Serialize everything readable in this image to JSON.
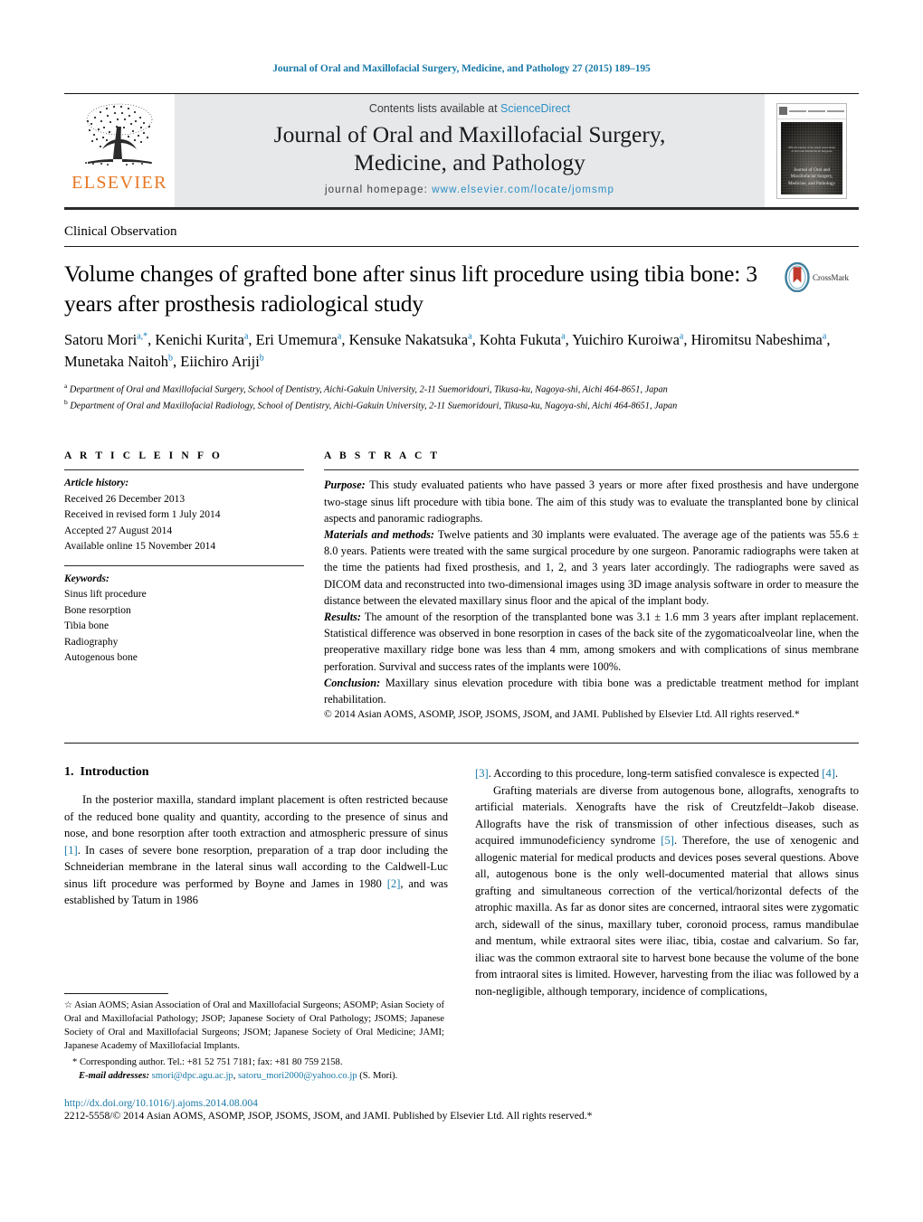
{
  "running_head": "Journal of Oral and Maxillofacial Surgery, Medicine, and Pathology 27 (2015) 189–195",
  "masthead": {
    "publisher_word": "ELSEVIER",
    "contents_prefix": "Contents lists available at ",
    "contents_link": "ScienceDirect",
    "journal_title_line1": "Journal of Oral and Maxillofacial Surgery,",
    "journal_title_line2": "Medicine, and Pathology",
    "homepage_prefix": "journal homepage: ",
    "homepage_url": "www.elsevier.com/locate/jomsmp",
    "cover_title": "Journal of Oral and Maxillofacial Surgery, Medicine, and Pathology",
    "cover_mini": "Official Journal of the Asian Association of Oral and Maxillofacial Surgeons"
  },
  "article": {
    "doctype": "Clinical Observation",
    "title": "Volume changes of grafted bone after sinus lift procedure using tibia bone: 3 years after prosthesis radiological study",
    "crossmark_label": "CrossMark",
    "authors": [
      {
        "name": "Satoru Mori",
        "sup": "a,*"
      },
      {
        "name": "Kenichi Kurita",
        "sup": "a"
      },
      {
        "name": "Eri Umemura",
        "sup": "a"
      },
      {
        "name": "Kensuke Nakatsuka",
        "sup": "a"
      },
      {
        "name": "Kohta Fukuta",
        "sup": "a"
      },
      {
        "name": "Yuichiro Kuroiwa",
        "sup": "a"
      },
      {
        "name": "Hiromitsu Nabeshima",
        "sup": "a"
      },
      {
        "name": "Munetaka Naitoh",
        "sup": "b"
      },
      {
        "name": "Eiichiro Ariji",
        "sup": "b"
      }
    ],
    "affiliations": [
      {
        "mark": "a",
        "text": "Department of Oral and Maxillofacial Surgery, School of Dentistry, Aichi-Gakuin University, 2-11 Suemoridouri, Tikusa-ku, Nagoya-shi, Aichi 464-8651, Japan"
      },
      {
        "mark": "b",
        "text": "Department of Oral and Maxillofacial Radiology, School of Dentistry, Aichi-Gakuin University, 2-11 Suemoridouri, Tikusa-ku, Nagoya-shi, Aichi 464-8651, Japan"
      }
    ]
  },
  "article_info": {
    "heading": "A R T I C L E   I N F O",
    "history_label": "Article history:",
    "history": [
      "Received 26 December 2013",
      "Received in revised form 1 July 2014",
      "Accepted 27 August 2014",
      "Available online 15 November 2014"
    ],
    "keywords_label": "Keywords:",
    "keywords": [
      "Sinus lift procedure",
      "Bone resorption",
      "Tibia bone",
      "Radiography",
      "Autogenous bone"
    ]
  },
  "abstract": {
    "heading": "A B S T R A C T",
    "sections": [
      {
        "label": "Purpose:",
        "text": " This study evaluated patients who have passed 3 years or more after fixed prosthesis and have undergone two-stage sinus lift procedure with tibia bone. The aim of this study was to evaluate the transplanted bone by clinical aspects and panoramic radiographs."
      },
      {
        "label": "Materials and methods:",
        "text": " Twelve patients and 30 implants were evaluated. The average age of the patients was 55.6 ± 8.0 years. Patients were treated with the same surgical procedure by one surgeon. Panoramic radiographs were taken at the time the patients had fixed prosthesis, and 1, 2, and 3 years later accordingly. The radiographs were saved as DICOM data and reconstructed into two-dimensional images using 3D image analysis software in order to measure the distance between the elevated maxillary sinus floor and the apical of the implant body."
      },
      {
        "label": "Results:",
        "text": " The amount of the resorption of the transplanted bone was 3.1 ± 1.6 mm 3 years after implant replacement. Statistical difference was observed in bone resorption in cases of the back site of the zygomaticoalveolar line, when the preoperative maxillary ridge bone was less than 4 mm, among smokers and with complications of sinus membrane perforation. Survival and success rates of the implants were 100%."
      },
      {
        "label": "Conclusion:",
        "text": " Maxillary sinus elevation procedure with tibia bone was a predictable treatment method for implant rehabilitation."
      }
    ],
    "copyright": "© 2014 Asian AOMS, ASOMP, JSOP, JSOMS, JSOM, and JAMI. Published by Elsevier Ltd. All rights reserved.*"
  },
  "body": {
    "section_number": "1.",
    "section_title": "Introduction",
    "left_paragraph_1a": "In the posterior maxilla, standard implant placement is often restricted because of the reduced bone quality and quantity, according to the presence of sinus and nose, and bone resorption after tooth extraction and atmospheric pressure of sinus ",
    "left_ref_1": "[1]",
    "left_paragraph_1b": ". In cases of severe bone resorption, preparation of a trap door including the Schneiderian membrane in the lateral sinus wall according to the Caldwell-Luc sinus lift procedure was performed by Boyne and James in 1980 ",
    "left_ref_2": "[2]",
    "left_paragraph_1c": ", and was established by Tatum in 1986 ",
    "right_ref_3": "[3]",
    "right_paragraph_1a": ". According to this procedure, long-term satisfied convalesce is expected ",
    "right_ref_4": "[4]",
    "right_paragraph_1b": ".",
    "right_paragraph_2a": "Grafting materials are diverse from autogenous bone, allografts, xenografts to artificial materials. Xenografts have the risk of Creutzfeldt–Jakob disease. Allografts have the risk of transmission of other infectious diseases, such as acquired immunodeficiency syndrome ",
    "right_ref_5": "[5]",
    "right_paragraph_2b": ". Therefore, the use of xenogenic and allogenic material for medical products and devices poses several questions. Above all, autogenous bone is the only well-documented material that allows sinus grafting and simultaneous correction of the vertical/horizontal defects of the atrophic maxilla. As far as donor sites are concerned, intraoral sites were zygomatic arch, sidewall of the sinus, maxillary tuber, coronoid process, ramus mandibulae and mentum, while extraoral sites were iliac, tibia, costae and calvarium. So far, iliac was the common extraoral site to harvest bone because the volume of the bone from intraoral sites is limited. However, harvesting from the iliac was followed by a non-negligible, although temporary, incidence of complications,"
  },
  "footnotes": {
    "societies": "Asian AOMS; Asian Association of Oral and Maxillofacial Surgeons; ASOMP; Asian Society of Oral and Maxillofacial Pathology; JSOP; Japanese Society of Oral Pathology; JSOMS; Japanese Society of Oral and Maxillofacial Surgeons; JSOM; Japanese Society of Oral Medicine; JAMI; Japanese Academy of Maxillofacial Implants.",
    "corresponding": "Corresponding author. Tel.: +81 52 751 7181; fax: +81 80 759 2158.",
    "email_label": "E-mail addresses:",
    "email_1": "smori@dpc.agu.ac.jp",
    "email_2": "satoru_mori2000@yahoo.co.jp",
    "email_suffix": "(S. Mori).",
    "star_glyph": "☆",
    "asterisk_glyph": "*"
  },
  "bottom": {
    "doi": "http://dx.doi.org/10.1016/j.ajoms.2014.08.004",
    "issn_line": "2212-5558/© 2014 Asian AOMS, ASOMP, JSOP, JSOMS, JSOM, and JAMI. Published by Elsevier Ltd. All rights reserved.*"
  },
  "colors": {
    "link_blue": "#1879a8",
    "science_direct_blue": "#2a8fc4",
    "elsevier_orange": "#e87722",
    "band_gray": "#e7e8ea",
    "crossmark_blue": "#3f7f9e",
    "crossmark_red": "#c0392b"
  }
}
